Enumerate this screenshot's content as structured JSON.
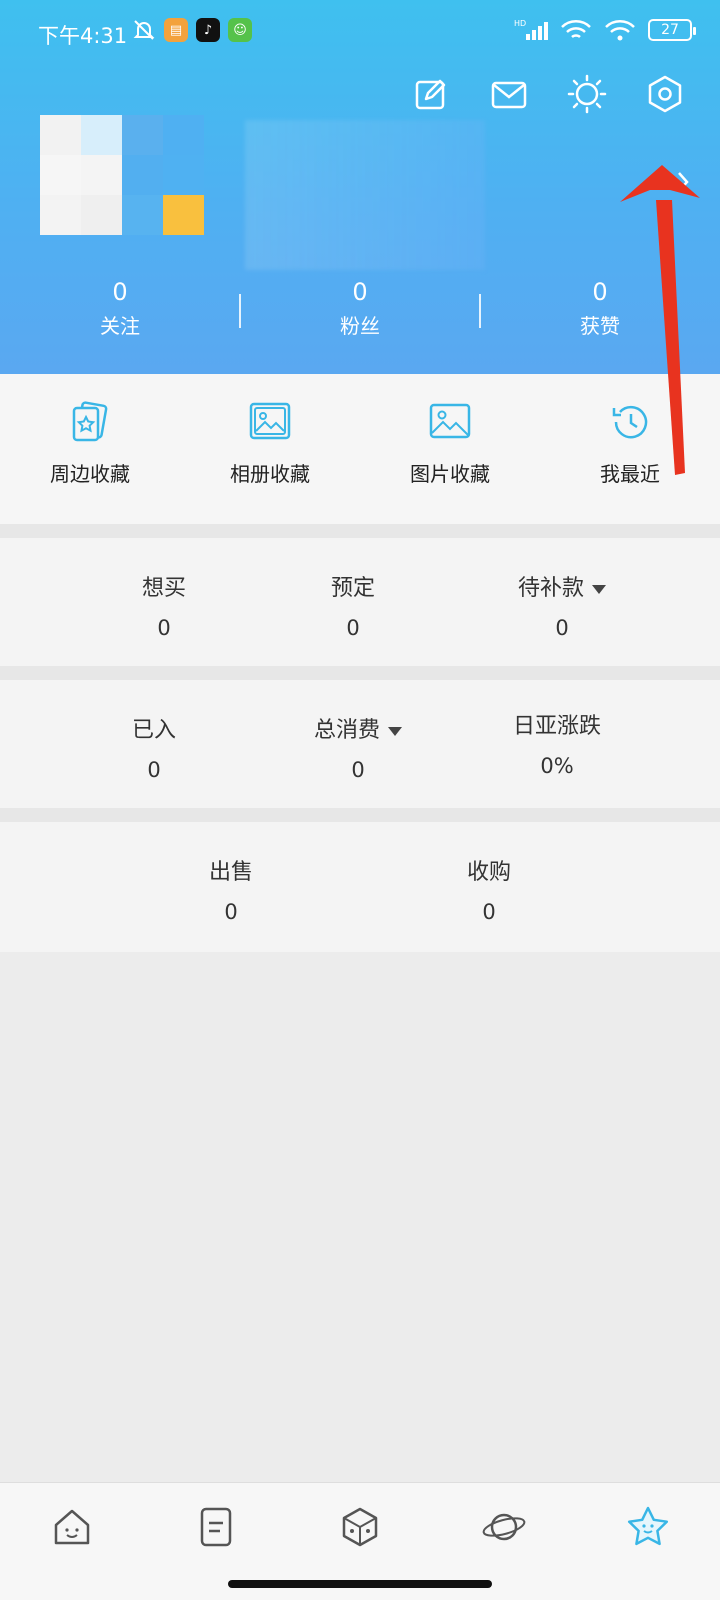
{
  "status_bar": {
    "time": "下午4:31",
    "battery": "27"
  },
  "header": {
    "actions": [
      "edit-icon",
      "mail-icon",
      "theme-icon",
      "settings-icon"
    ],
    "stats": [
      {
        "value": "0",
        "label": "关注"
      },
      {
        "value": "0",
        "label": "粉丝"
      },
      {
        "value": "0",
        "label": "获赞"
      }
    ]
  },
  "shortcuts": [
    {
      "label": "周边收藏",
      "icon": "cards-star-icon"
    },
    {
      "label": "相册收藏",
      "icon": "album-icon"
    },
    {
      "label": "图片收藏",
      "icon": "image-icon"
    },
    {
      "label": "我最近",
      "icon": "history-icon"
    }
  ],
  "panel1": {
    "items": [
      {
        "label": "想买",
        "value": "0"
      },
      {
        "label": "预定",
        "value": "0"
      },
      {
        "label": "待补款",
        "value": "0"
      }
    ]
  },
  "panel2": {
    "items": [
      {
        "label": "已入",
        "value": "0"
      },
      {
        "label": "总消费",
        "value": "0"
      },
      {
        "label": "日亚涨跌",
        "value": "0%"
      }
    ]
  },
  "panel3": {
    "items": [
      {
        "label": "出售",
        "value": "0"
      },
      {
        "label": "收购",
        "value": "0"
      }
    ]
  },
  "bottom_nav": {
    "items": [
      "home-icon",
      "notes-icon",
      "dice-icon",
      "planet-icon",
      "star-icon"
    ]
  },
  "colors": {
    "header_top": "#3fc0ef",
    "header_bottom": "#5aa8f1",
    "accent": "#39b6e6",
    "arrow": "#e8331f"
  }
}
